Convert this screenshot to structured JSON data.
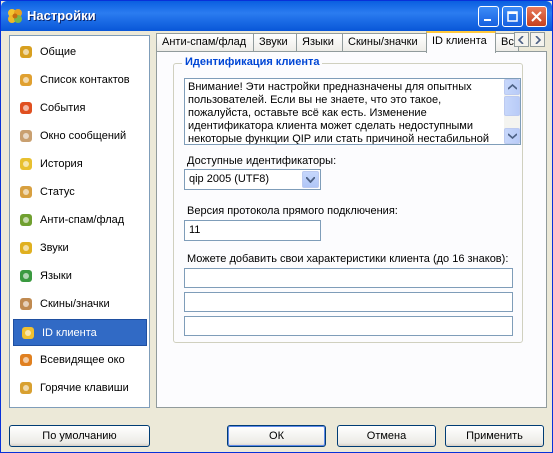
{
  "window": {
    "title": "Настройки"
  },
  "sidebar": {
    "items": [
      {
        "label": "Общие",
        "icon": "gear-person-icon",
        "color": "#d8a020"
      },
      {
        "label": "Список контактов",
        "icon": "contacts-icon",
        "color": "#e0a030"
      },
      {
        "label": "События",
        "icon": "events-icon",
        "color": "#e05020"
      },
      {
        "label": "Окно сообщений",
        "icon": "message-window-icon",
        "color": "#c9a070"
      },
      {
        "label": "История",
        "icon": "history-icon",
        "color": "#e8c030"
      },
      {
        "label": "Статус",
        "icon": "status-icon",
        "color": "#d8a040"
      },
      {
        "label": "Анти-спам/флад",
        "icon": "antispam-icon",
        "color": "#70a030"
      },
      {
        "label": "Звуки",
        "icon": "sounds-icon",
        "color": "#e0b020"
      },
      {
        "label": "Языки",
        "icon": "languages-icon",
        "color": "#3a9a40"
      },
      {
        "label": "Скины/значки",
        "icon": "skins-icon",
        "color": "#c08a50"
      },
      {
        "label": "ID клиента",
        "icon": "client-id-icon",
        "color": "#f0c030",
        "active": true
      },
      {
        "label": "Всевидящее око",
        "icon": "all-seeing-eye-icon",
        "color": "#e08020"
      },
      {
        "label": "Горячие клавиши",
        "icon": "hotkeys-icon",
        "color": "#d8a030"
      }
    ]
  },
  "tabs": [
    {
      "label": "Анти-спам/флад"
    },
    {
      "label": "Звуки"
    },
    {
      "label": "Языки"
    },
    {
      "label": "Скины/значки"
    },
    {
      "label": "ID клиента",
      "active": true
    },
    {
      "label": "Все"
    }
  ],
  "group": {
    "title": "Идентификация клиента",
    "warning": "Внимание! Эти настройки предназначены для опытных пользователей. Если вы не знаете, что это такое, пожалуйста, оставьте всё как есть. Изменение идентификатора клиента может сделать недоступными некоторые функции QIP или стать причиной нестабильной",
    "identifiers_label": "Доступные идентификаторы:",
    "identifier_value": "qip 2005 (UTF8)",
    "protocol_label": "Версия протокола прямого подключения:",
    "protocol_value": "11",
    "custom_label": "Можете добавить свои характеристики клиента (до 16 знаков):",
    "custom_fields": [
      "",
      "",
      ""
    ]
  },
  "buttons": {
    "defaults": "По умолчанию",
    "ok": "ОК",
    "cancel": "Отмена",
    "apply": "Применить"
  },
  "colors": {
    "accent": "#316ac5",
    "titlebar": "#0a5fe0",
    "group_title": "#0046d5"
  }
}
